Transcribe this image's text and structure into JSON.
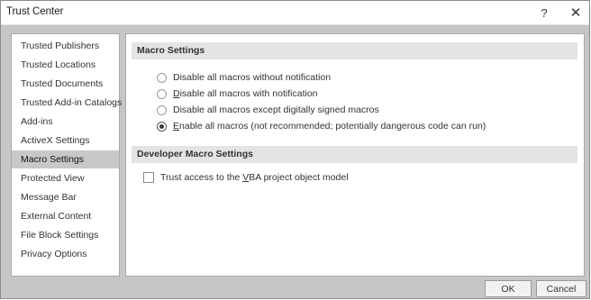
{
  "window": {
    "title": "Trust Center",
    "help_glyph": "?",
    "close_glyph": "✕"
  },
  "sidebar": {
    "items": [
      {
        "label": "Trusted Publishers"
      },
      {
        "label": "Trusted Locations"
      },
      {
        "label": "Trusted Documents"
      },
      {
        "label": "Trusted Add-in Catalogs"
      },
      {
        "label": "Add-ins"
      },
      {
        "label": "ActiveX Settings"
      },
      {
        "label": "Macro Settings",
        "selected": true
      },
      {
        "label": "Protected View"
      },
      {
        "label": "Message Bar"
      },
      {
        "label": "External Content"
      },
      {
        "label": "File Block Settings"
      },
      {
        "label": "Privacy Options"
      }
    ]
  },
  "macro_settings": {
    "header": "Macro Settings",
    "options": [
      {
        "accel": "",
        "rest": "Disable all macros without notification",
        "checked": false
      },
      {
        "accel": "D",
        "rest": "isable all macros with notification",
        "checked": false
      },
      {
        "accel": "",
        "rest": "Disable all macros except digitally signed macros",
        "checked": false
      },
      {
        "accel": "E",
        "rest": "nable all macros (not recommended; potentially dangerous code can run)",
        "checked": true
      }
    ]
  },
  "developer_settings": {
    "header": "Developer Macro Settings",
    "trust_vba": {
      "pre": "Trust access to the ",
      "accel": "V",
      "post": "BA project object model",
      "checked": false
    }
  },
  "footer": {
    "ok_label": "OK",
    "cancel_label": "Cancel"
  }
}
